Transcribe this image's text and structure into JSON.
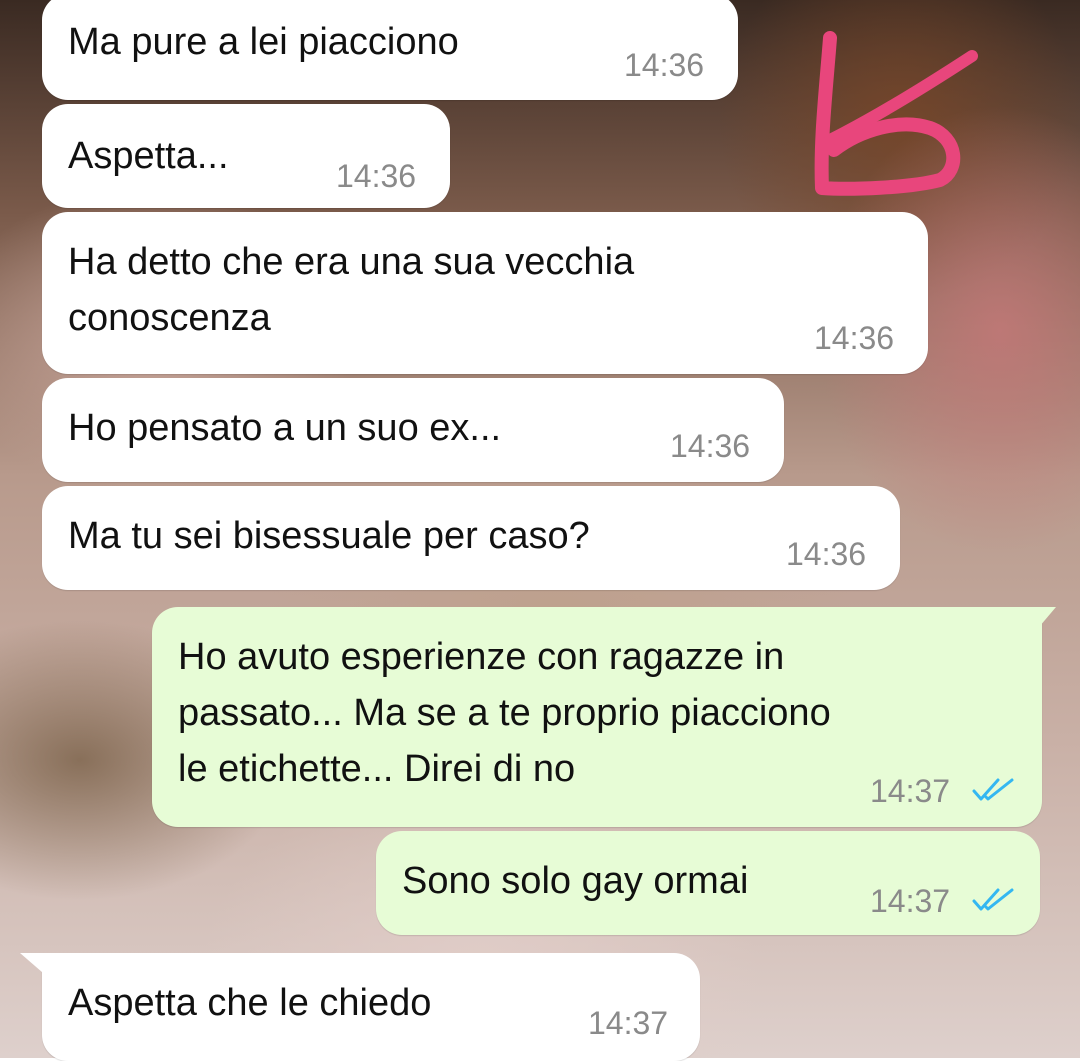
{
  "chat": {
    "messages": [
      {
        "id": "m1",
        "direction": "incoming",
        "text": "Ma pure a lei piacciono",
        "time": "14:36"
      },
      {
        "id": "m2",
        "direction": "incoming",
        "text": "Aspetta...",
        "time": "14:36"
      },
      {
        "id": "m3",
        "direction": "incoming",
        "text": "Ha detto che era una sua vecchia\nconoscenza",
        "time": "14:36"
      },
      {
        "id": "m4",
        "direction": "incoming",
        "text": "Ho pensato a un suo ex...",
        "time": "14:36"
      },
      {
        "id": "m5",
        "direction": "incoming",
        "text": "Ma tu sei bisessuale per caso?",
        "time": "14:36"
      },
      {
        "id": "m6",
        "direction": "outgoing",
        "text": "Ho avuto esperienze con ragazze in\npassato... Ma se a te proprio piacciono\nle etichette... Direi di no",
        "time": "14:37",
        "status": "read"
      },
      {
        "id": "m7",
        "direction": "outgoing",
        "text": "Sono solo gay ormai",
        "time": "14:37",
        "status": "read"
      },
      {
        "id": "m8",
        "direction": "incoming",
        "text": "Aspetta che le chiedo",
        "time": "14:37"
      }
    ]
  },
  "colors": {
    "incoming_bubble": "#ffffff",
    "outgoing_bubble": "#e7fcd6",
    "read_ticks": "#34b7f1",
    "annotation": "#e8467c"
  },
  "icons": {
    "read_status": "double-check-icon",
    "annotation": "handwritten-number-scrawl"
  }
}
